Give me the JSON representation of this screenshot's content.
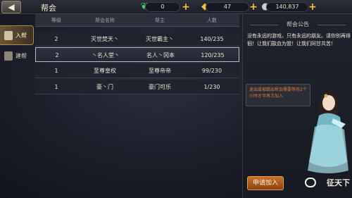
{
  "header": {
    "back_icon": "arrow-left-icon",
    "title": "帮会",
    "resources": [
      {
        "icon": "jade-icon",
        "value": "0"
      },
      {
        "icon": "gold-ingot-icon",
        "value": "47"
      },
      {
        "icon": "silver-coin-icon",
        "value": "140,837"
      }
    ]
  },
  "sidebar": {
    "tabs": [
      {
        "label": "入帮",
        "active": true
      },
      {
        "label": "建帮",
        "active": false
      }
    ]
  },
  "guild_table": {
    "columns": [
      "等级",
      "帮会名称",
      "帮主",
      "人数"
    ],
    "rows": [
      [
        "2",
        "灭世焚天丶",
        "灭世霸主丶",
        "140/235"
      ],
      [
        "2",
        "丶名人堂丶",
        "名人丶冈本",
        "120/235"
      ],
      [
        "1",
        "至尊皇权",
        "至尊帝帝",
        "99/230"
      ],
      [
        "1",
        "豪丶门",
        "豪门可乐",
        "1/230"
      ]
    ],
    "selected_row": 1
  },
  "notice": {
    "title": "帮会公告",
    "text": "没有永远的游戏，只有永远的朋友。请你别再徘徊！让我们歃血为盟！让我们同甘共苦！",
    "hint": "退出或被踢出帮会需要等待2个小时才可再次加入",
    "apply_label": "申请加入",
    "logo_text": "征天下"
  },
  "colors": {
    "accent": "#c9702b",
    "hint": "#e0793c"
  }
}
